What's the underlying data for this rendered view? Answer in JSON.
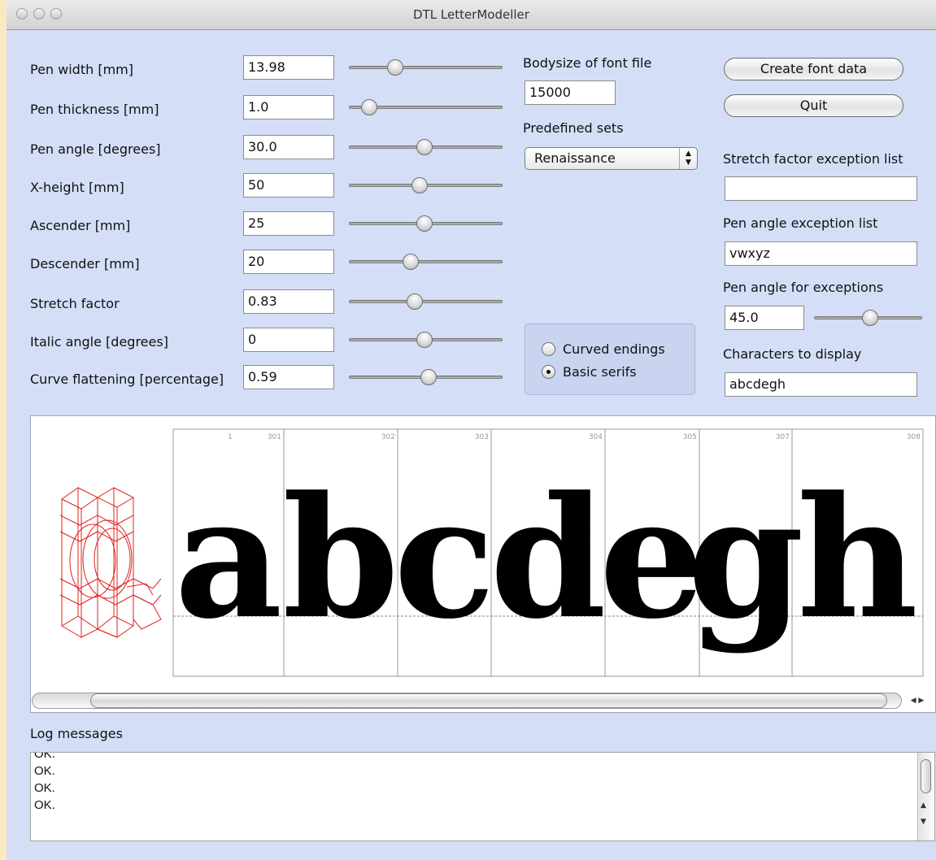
{
  "window": {
    "title": "DTL LetterModeller"
  },
  "params": [
    {
      "label": "Pen width [mm]",
      "value": "13.98",
      "slider_fraction": 0.3
    },
    {
      "label": "Pen thickness [mm]",
      "value": "1.0",
      "slider_fraction": 0.13
    },
    {
      "label": "Pen angle [degrees]",
      "value": "30.0",
      "slider_fraction": 0.49
    },
    {
      "label": "X-height [mm]",
      "value": "50",
      "slider_fraction": 0.46
    },
    {
      "label": "Ascender [mm]",
      "value": "25",
      "slider_fraction": 0.49
    },
    {
      "label": "Descender [mm]",
      "value": "20",
      "slider_fraction": 0.4
    },
    {
      "label": "Stretch factor",
      "value": "0.83",
      "slider_fraction": 0.43
    },
    {
      "label": "Italic angle [degrees]",
      "value": "0",
      "slider_fraction": 0.49
    },
    {
      "label": "Curve flattening [percentage]",
      "value": "0.59",
      "slider_fraction": 0.52
    }
  ],
  "bodysize": {
    "label": "Bodysize of font file",
    "value": "15000"
  },
  "predefined": {
    "label": "Predefined sets",
    "value": "Renaissance"
  },
  "ending_options": [
    {
      "label": "Curved endings",
      "selected": false
    },
    {
      "label": "Basic serifs",
      "selected": true
    }
  ],
  "buttons": {
    "create": "Create font data",
    "quit": "Quit"
  },
  "stretch_exception": {
    "label": "Stretch factor exception list",
    "value": ""
  },
  "pen_angle_exception": {
    "label": "Pen angle exception list",
    "value": "vwxyz"
  },
  "pen_angle_for_exceptions": {
    "label": "Pen angle for exceptions",
    "value": "45.0",
    "slider_fraction": 0.52
  },
  "characters_display": {
    "label": "Characters to display",
    "value": "abcdegh"
  },
  "preview": {
    "glyphs": [
      "a",
      "b",
      "c",
      "d",
      "e",
      "g",
      "h"
    ],
    "top_number_first": "1",
    "codes": [
      "301",
      "302",
      "303",
      "304",
      "305",
      "307",
      "308"
    ]
  },
  "log": {
    "label": "Log messages",
    "lines": [
      "OK.",
      "OK.",
      "OK.",
      "OK."
    ]
  },
  "colors": {
    "background": "#d4def7",
    "construction": "#e0201e",
    "glyph": "#000000"
  }
}
